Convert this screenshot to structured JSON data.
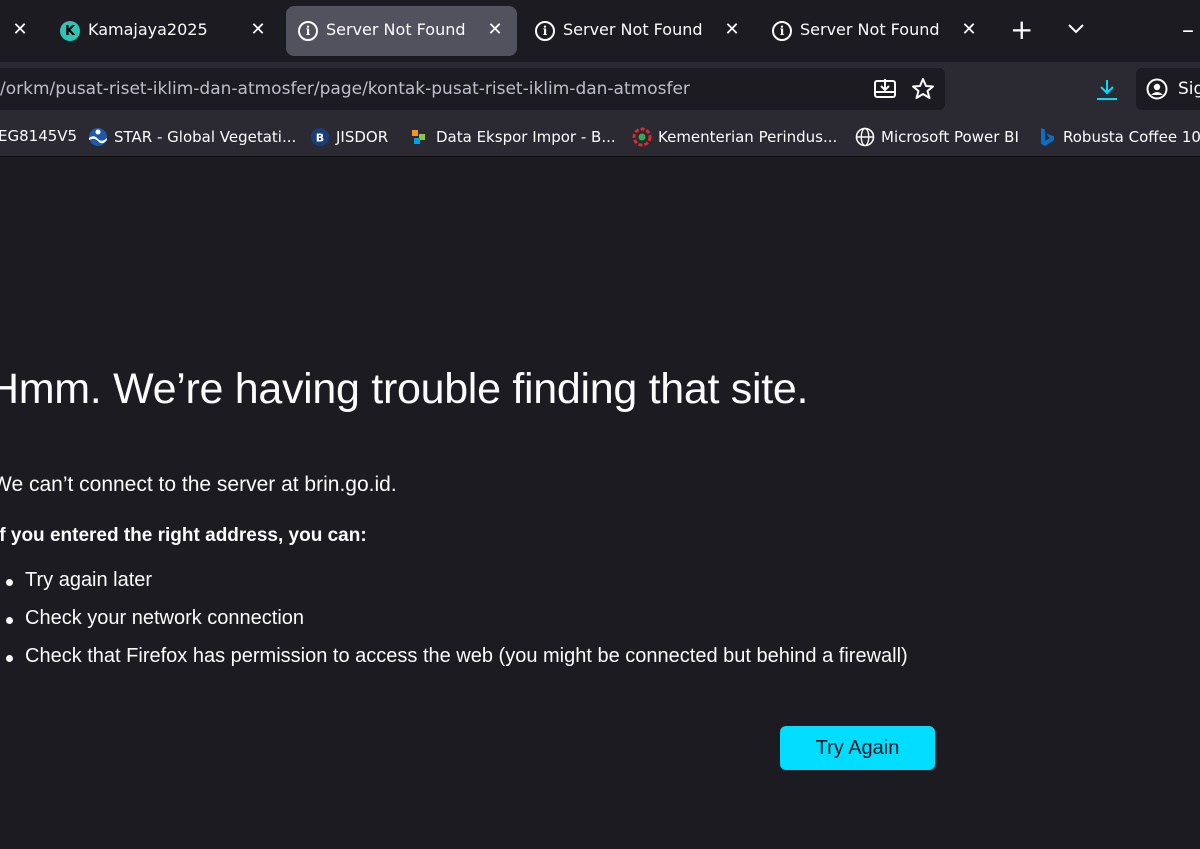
{
  "tabs": [
    {
      "title": "",
      "close": "✕",
      "active": false
    },
    {
      "title": "Kamajaya2025",
      "close": "✕",
      "favicon": "k-logo-icon",
      "active": false
    },
    {
      "title": "Server Not Found",
      "close": "✕",
      "favicon": "info-icon",
      "active": true
    },
    {
      "title": "Server Not Found",
      "close": "✕",
      "favicon": "info-icon",
      "active": false
    },
    {
      "title": "Server Not Found",
      "close": "✕",
      "favicon": "info-icon",
      "active": false
    }
  ],
  "tabbar": {
    "new_tab": "+",
    "list_all": "⌄",
    "minimize": "–"
  },
  "urlbar": {
    "url": "/orkm/pusat-riset-iklim-dan-atmosfer/page/kontak-pusat-riset-iklim-dan-atmosfer"
  },
  "account": {
    "label": "Sig"
  },
  "bookmarks": [
    {
      "label": "EG8145V5",
      "icon": "none"
    },
    {
      "label": "STAR - Global Vegetati...",
      "icon": "noaa-icon"
    },
    {
      "label": "JISDOR",
      "icon": "bi-icon"
    },
    {
      "label": "Data Ekspor Impor - B...",
      "icon": "bps-icon"
    },
    {
      "label": "Kementerian Perindus...",
      "icon": "kemenperin-icon"
    },
    {
      "label": "Microsoft Power BI",
      "icon": "globe-icon"
    },
    {
      "label": "Robusta Coffee 10...",
      "icon": "bing-icon"
    }
  ],
  "error": {
    "title": "Hmm. We’re having trouble finding that site.",
    "description": "We can’t connect to the server at brin.go.id.",
    "help_heading": "If you entered the right address, you can:",
    "suggestions": [
      "Try again later",
      "Check your network connection",
      "Check that Firefox has permission to access the web (you might be connected but behind a firewall)"
    ],
    "try_again": "Try Again"
  },
  "colors": {
    "accent": "#00ddff",
    "background": "#1c1b22",
    "toolbar": "#2b2a33"
  }
}
